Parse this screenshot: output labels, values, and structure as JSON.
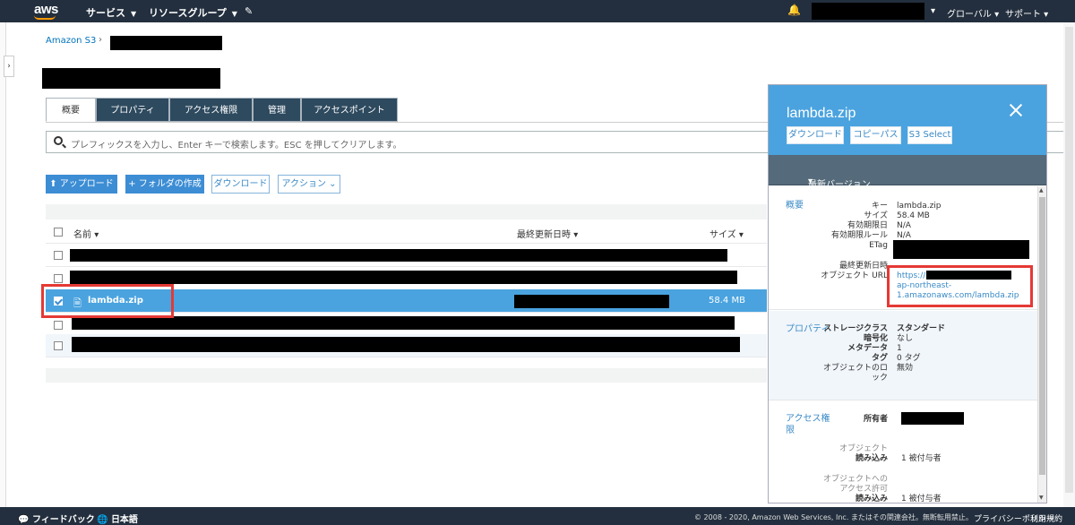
{
  "topnav": {
    "logo": "aws",
    "services": "サービス",
    "resource_groups": "リソースグループ",
    "global": "グローバル",
    "support": "サポート"
  },
  "breadcrumb": {
    "root": "Amazon S3"
  },
  "tabs": [
    {
      "label": "概要"
    },
    {
      "label": "プロパティ"
    },
    {
      "label": "アクセス権限"
    },
    {
      "label": "管理"
    },
    {
      "label": "アクセスポイント"
    }
  ],
  "search": {
    "placeholder": "プレフィックスを入力し、Enter キーで検索します。ESC を押してクリアします。"
  },
  "toolbar": {
    "upload": "アップロード",
    "create_folder": "フォルダの作成",
    "download": "ダウンロード",
    "actions": "アクション"
  },
  "table": {
    "columns": {
      "name": "名前",
      "last_modified": "最終更新日時",
      "size": "サイズ"
    },
    "selected_row": {
      "name": "lambda.zip",
      "size": "58.4 MB"
    }
  },
  "panel": {
    "title": "lambda.zip",
    "buttons": {
      "download": "ダウンロード",
      "copy_path": "コピーパス",
      "s3_select": "S3 Select"
    },
    "version": "最新バージョン",
    "overview": {
      "heading": "概要",
      "key_label": "キー",
      "key_value": "lambda.zip",
      "size_label": "サイズ",
      "size_value": "58.4 MB",
      "expiry_date_label": "有効期限日",
      "expiry_date_value": "N/A",
      "expiry_rule_label": "有効期限ルール",
      "expiry_rule_value": "N/A",
      "etag_label": "ETag",
      "last_modified_label": "最終更新日時",
      "object_url_label": "オブジェクト URL",
      "object_url_line1": "https://",
      "object_url_line2": "ap-northeast-",
      "object_url_line3": "1.amazonaws.com/lambda.zip"
    },
    "properties": {
      "heading": "プロパティ",
      "storage_class_label": "ストレージクラス",
      "storage_class_value": "スタンダード",
      "encryption_label": "暗号化",
      "encryption_value": "なし",
      "metadata_label": "メタデータ",
      "metadata_value": "1",
      "tags_label": "タグ",
      "tags_value": "0 タグ",
      "object_lock_label_1": "オブジェクトのロ",
      "object_lock_label_2": "ック",
      "object_lock_value": "無効"
    },
    "access": {
      "heading_1": "アクセス権",
      "heading_2": "限",
      "owner_label": "所有者",
      "object_group": "オブジェクト",
      "object_read_label": "読み込み",
      "object_read_value": "1 被付与者",
      "perm_group_1": "オブジェクトへの",
      "perm_group_2": "アクセス許可",
      "perm_read_label": "読み込み",
      "perm_read_value": "1 被付与者"
    }
  },
  "footer": {
    "feedback": "フィードバック",
    "language": "日本語",
    "copyright": "© 2008 - 2020, Amazon Web Services, Inc. またはその関連会社。無断転用禁止。",
    "privacy": "プライバシーポリシー",
    "terms": "利用規約"
  },
  "colors": {
    "nav_bg": "#232f3e",
    "accent": "#4aa3df",
    "tab_bg": "#2e4a5f",
    "highlight_red": "#e53935"
  }
}
